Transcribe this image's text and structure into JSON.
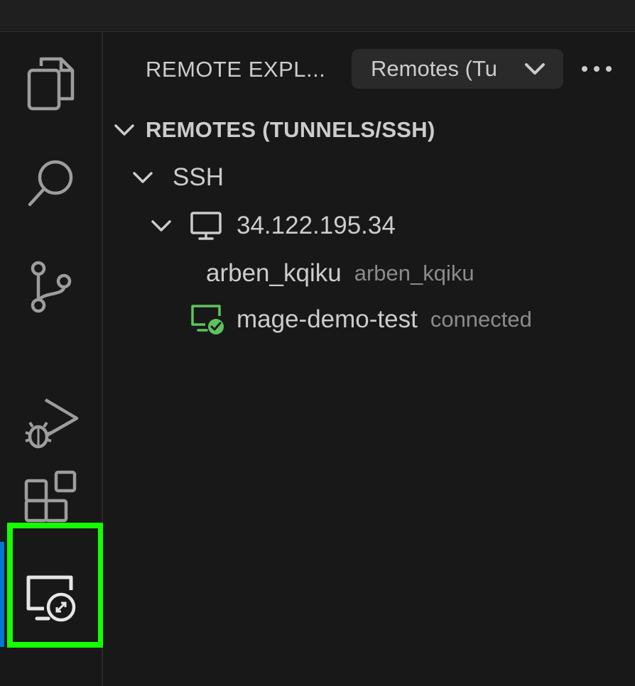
{
  "colors": {
    "background": "#181818",
    "activity_active": "#0078d4",
    "highlight": "#14ff00",
    "connected_green": "#5ec35e"
  },
  "activity_bar": {
    "items": [
      {
        "icon": "files-icon"
      },
      {
        "icon": "search-icon"
      },
      {
        "icon": "source-control-icon"
      },
      {
        "icon": "run-debug-icon"
      },
      {
        "icon": "extensions-icon"
      },
      {
        "icon": "remote-explorer-icon",
        "active": true
      }
    ]
  },
  "sidebar": {
    "title": "REMOTE EXPL...",
    "view_select": {
      "value": "Remotes (Tu"
    },
    "more_icon": "ellipsis-icon",
    "section": {
      "title": "REMOTES (TUNNELS/SSH)"
    },
    "ssh_group": {
      "label": "SSH"
    },
    "host": {
      "label": "34.122.195.34"
    },
    "user_entry": {
      "label": "arben_kqiku",
      "description": "arben_kqiku"
    },
    "connected_entry": {
      "label": "mage-demo-test",
      "description": "connected"
    }
  }
}
